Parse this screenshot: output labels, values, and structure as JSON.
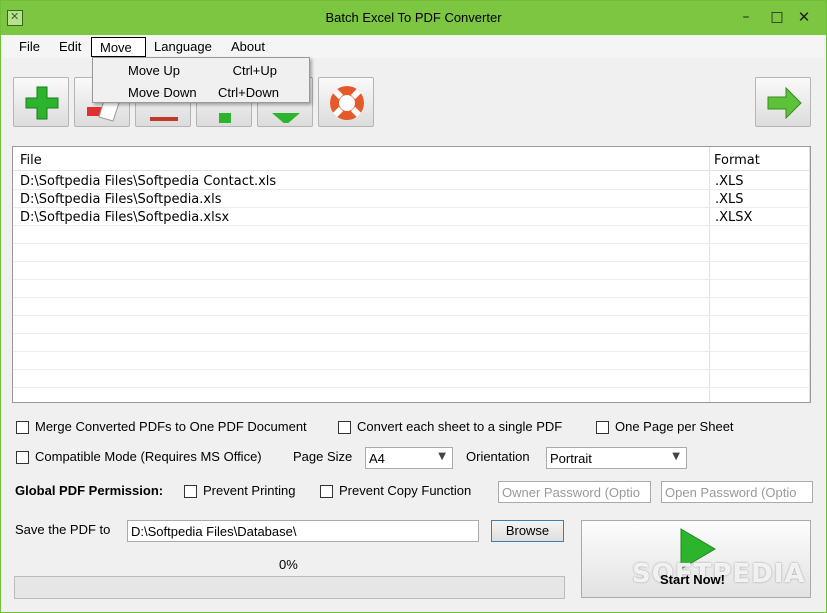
{
  "window": {
    "title": "Batch Excel To PDF Converter",
    "controls": {
      "minimize": "–",
      "maximize": "□",
      "close": "✕"
    }
  },
  "menubar": {
    "items": [
      "File",
      "Edit",
      "Move",
      "Language",
      "About"
    ],
    "active": "Move"
  },
  "dropdown": {
    "items": [
      {
        "label": "Move Up",
        "shortcut": "Ctrl+Up"
      },
      {
        "label": "Move Down",
        "shortcut": "Ctrl+Down"
      }
    ]
  },
  "toolbar": {
    "buttons": [
      {
        "icon": "add-icon"
      },
      {
        "icon": "remove-icon"
      },
      {
        "icon": "clear-icon"
      },
      {
        "icon": "move-up-icon"
      },
      {
        "icon": "move-down-icon"
      },
      {
        "icon": "help-lifebuoy-icon"
      },
      {
        "icon": "next-arrow-icon"
      }
    ]
  },
  "filelist": {
    "columns": [
      "File",
      "Format"
    ],
    "rows": [
      {
        "file": "D:\\Softpedia Files\\Softpedia Contact.xls",
        "format": ".XLS"
      },
      {
        "file": "D:\\Softpedia Files\\Softpedia.xls",
        "format": ".XLS"
      },
      {
        "file": "D:\\Softpedia Files\\Softpedia.xlsx",
        "format": ".XLSX"
      }
    ]
  },
  "options": {
    "merge": "Merge Converted PDFs to One PDF Document",
    "each_sheet": "Convert each sheet to a single PDF",
    "one_page": "One Page per Sheet",
    "compatible": "Compatible Mode (Requires MS Office)",
    "page_size_label": "Page Size",
    "page_size_value": "A4",
    "orientation_label": "Orientation",
    "orientation_value": "Portrait"
  },
  "permission": {
    "label": "Global PDF Permission:",
    "prevent_printing": "Prevent Printing",
    "prevent_copy": "Prevent Copy Function",
    "owner_password_placeholder": "Owner Password (Optio",
    "open_password_placeholder": "Open Password (Optio"
  },
  "save": {
    "label": "Save the PDF to",
    "path": "D:\\Softpedia Files\\Database\\",
    "browse": "Browse"
  },
  "progress": {
    "text": "0%",
    "value": 0
  },
  "start": {
    "label": "Start Now!",
    "watermark": "SOFTPEDIA"
  },
  "colors": {
    "titlebar": "#7dc642",
    "accent_green": "#2db42d",
    "progress_fill": "#06b025"
  }
}
